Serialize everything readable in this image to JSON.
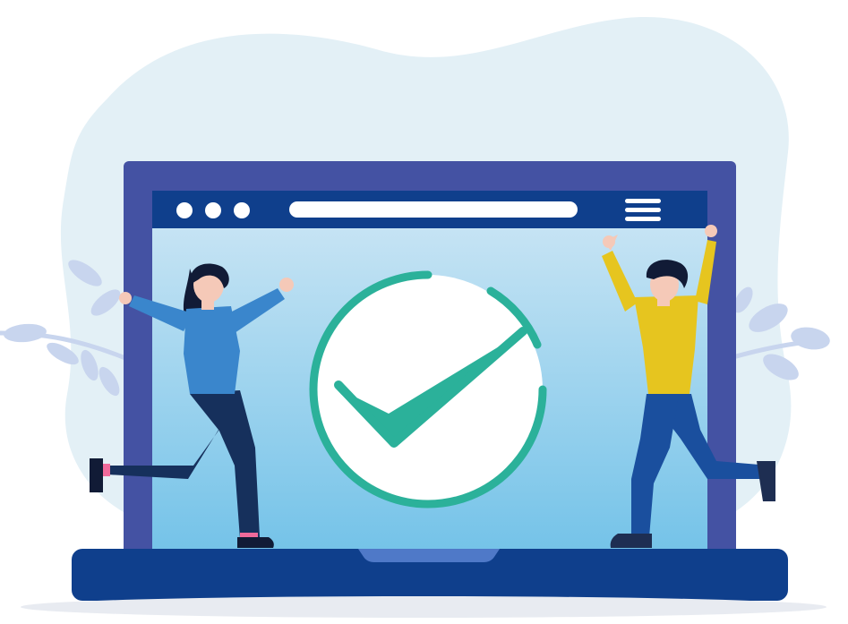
{
  "illustration": {
    "icons": {
      "window_dots": "three-dots-icon",
      "menu": "hamburger-menu-icon",
      "success": "check-circle-icon"
    },
    "colors": {
      "background_blob": "#e3f0f6",
      "laptop_frame": "#4452a3",
      "laptop_base": "#0f3f8c",
      "browser_bar": "#0f3f8c",
      "screen_top": "#cfe7f5",
      "screen_bottom": "#72c2e8",
      "check_accent": "#2bb19a",
      "leaves": "#c8d5ee",
      "woman_shirt": "#3a86cc",
      "woman_pants": "#16305c",
      "man_shirt": "#e6c51f",
      "man_pants": "#1a4f9e",
      "skin": "#f5c9b8",
      "hair": "#111b36"
    }
  }
}
